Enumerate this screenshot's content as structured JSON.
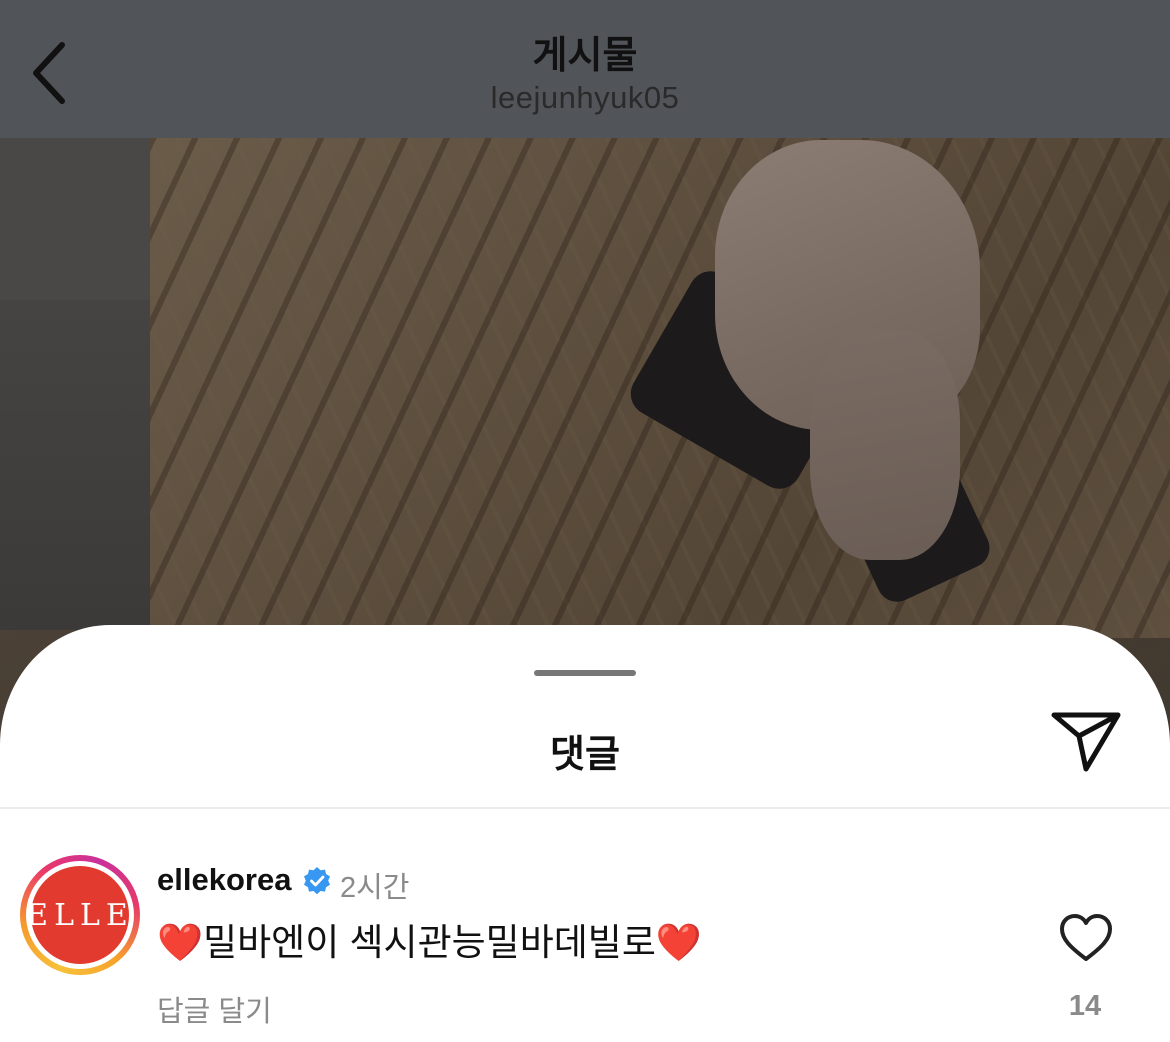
{
  "header": {
    "title": "게시물",
    "username": "leejunhyuk05"
  },
  "sheet": {
    "title": "댓글"
  },
  "comment": {
    "username": "ellekorea",
    "time": "2시간",
    "avatar_text": "ELLE",
    "text": "❤️밀바엔이 섹시관능밀바데빌로❤️",
    "reply_label": "답글 달기",
    "like_count": "14"
  },
  "icons": {
    "back": "chevron-left-icon",
    "share": "paper-plane-icon",
    "verified": "verified-badge-icon",
    "like": "heart-outline-icon"
  },
  "colors": {
    "verified": "#3897f0",
    "avatar_bg": "#e23a2f",
    "secondary_text": "#8a8a8a"
  }
}
